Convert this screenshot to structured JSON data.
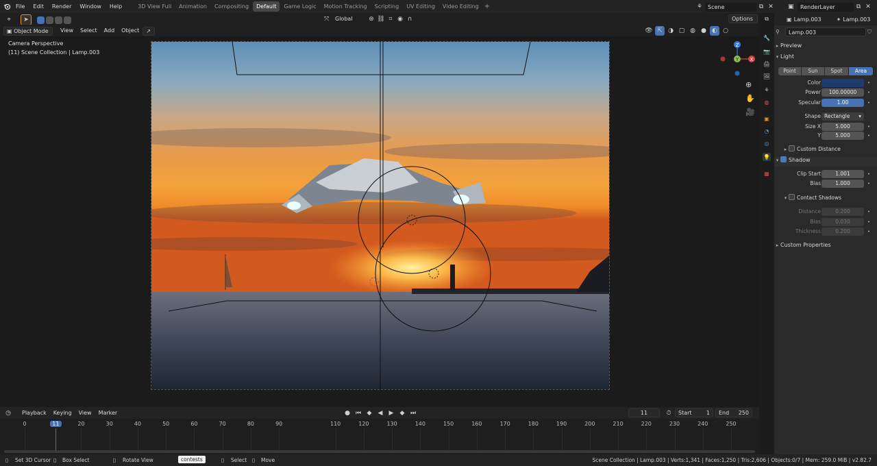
{
  "menu": {
    "file": "File",
    "edit": "Edit",
    "render": "Render",
    "window": "Window",
    "help": "Help"
  },
  "workspaces": [
    "3D View Full",
    "Animation",
    "Compositing",
    "Default",
    "Game Logic",
    "Motion Tracking",
    "Scripting",
    "UV Editing",
    "Video Editing"
  ],
  "active_workspace": "Default",
  "scene": {
    "label": "Scene"
  },
  "render_layer": {
    "label": "RenderLayer"
  },
  "header": {
    "orientation": "Global",
    "options": "Options"
  },
  "viewport_header": {
    "mode": "Object Mode",
    "view": "View",
    "select": "Select",
    "add": "Add",
    "object": "Object"
  },
  "viewport": {
    "perspective": "Camera Perspective",
    "collection": "(11) Scene Collection | Lamp.003"
  },
  "properties": {
    "object_name": "Lamp.003",
    "data_name": "Lamp.003",
    "search_value": "Lamp.003",
    "preview": "Preview",
    "light": "Light",
    "light_types": [
      "Point",
      "Sun",
      "Spot",
      "Area"
    ],
    "light_type_active": "Area",
    "color_label": "Color",
    "color_value": "#1e3a6e",
    "power_label": "Power",
    "power_value": "100.00000",
    "specular_label": "Specular",
    "specular_value": "1.00",
    "shape_label": "Shape",
    "shape_value": "Rectangle",
    "sizex_label": "Size X",
    "sizex_value": "5.000",
    "y_label": "Y",
    "y_value": "5.000",
    "custom_distance": "Custom Distance",
    "shadow": "Shadow",
    "clip_start_label": "Clip Start",
    "clip_start_value": "1.001",
    "bias_label": "Bias",
    "bias_value": "1.000",
    "contact_shadows": "Contact Shadows",
    "distance_label": "Distance",
    "distance_value": "0.200",
    "cbias_label": "Bias",
    "cbias_value": "0.030",
    "thickness_label": "Thickness",
    "thickness_value": "0.200",
    "custom_properties": "Custom Properties"
  },
  "timeline": {
    "playback": "Playback",
    "keying": "Keying",
    "view": "View",
    "marker": "Marker",
    "current_frame": "11",
    "start_label": "Start",
    "start_value": "1",
    "end_label": "End",
    "end_value": "250",
    "ticks": [
      "0",
      "11",
      "20",
      "30",
      "40",
      "50",
      "60",
      "70",
      "80",
      "90",
      "110",
      "120",
      "130",
      "140",
      "150",
      "160",
      "170",
      "180",
      "190",
      "200",
      "210",
      "220",
      "230",
      "240",
      "250"
    ]
  },
  "status": {
    "cursor": "Set 3D Cursor",
    "box": "Box Select",
    "rotate": "Rotate View",
    "tooltip": "contests",
    "select": "Select",
    "move": "Move",
    "info": "Scene Collection | Lamp.003 | Verts:1,341 | Faces:1,250 | Tris:2,606 | Objects:0/7 | Mem: 259.0 MiB | v2.82.7"
  },
  "colors": {
    "accent": "#4772b3",
    "active_tab": "#474747",
    "panel": "#2a2a2a"
  }
}
